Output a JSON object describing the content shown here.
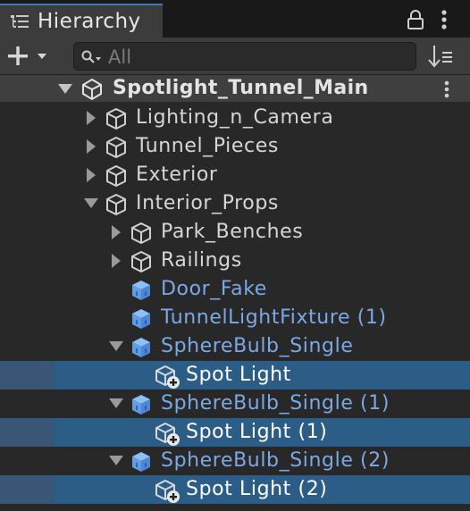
{
  "window": {
    "tab_title": "Hierarchy",
    "tab_icon": "hierarchy-list-icon",
    "lock_icon": "lock-icon",
    "menu_icon": "kebab-menu-icon"
  },
  "toolbar": {
    "create_icon": "plus-icon",
    "search_placeholder": "All",
    "sort_icon": "sort-icon"
  },
  "scene": {
    "name": "Spotlight_Tunnel_Main",
    "icon": "unity-logo-icon"
  },
  "tree": [
    {
      "label": "Lighting_n_Camera",
      "type": "gameobject",
      "expanded": false
    },
    {
      "label": "Tunnel_Pieces",
      "type": "gameobject",
      "expanded": false
    },
    {
      "label": "Exterior",
      "type": "gameobject",
      "expanded": false
    },
    {
      "label": "Interior_Props",
      "type": "gameobject",
      "expanded": true
    },
    {
      "label": "Park_Benches",
      "type": "gameobject",
      "expanded": false
    },
    {
      "label": "Railings",
      "type": "gameobject",
      "expanded": false
    },
    {
      "label": "Door_Fake",
      "type": "prefab"
    },
    {
      "label": "TunnelLightFixture (1)",
      "type": "prefab"
    },
    {
      "label": "SphereBulb_Single",
      "type": "prefab",
      "expanded": true
    },
    {
      "label": "Spot Light",
      "type": "added-object",
      "selected": true
    },
    {
      "label": "SphereBulb_Single (1)",
      "type": "prefab",
      "expanded": true
    },
    {
      "label": "Spot Light (1)",
      "type": "added-object",
      "selected": true
    },
    {
      "label": "SphereBulb_Single (2)",
      "type": "prefab",
      "expanded": true
    },
    {
      "label": "Spot Light (2)",
      "type": "added-object",
      "selected": true
    }
  ],
  "colors": {
    "selection": "#2c5d87",
    "prefab_text": "#7ba8e6",
    "tab_accent": "#3a79bb"
  }
}
